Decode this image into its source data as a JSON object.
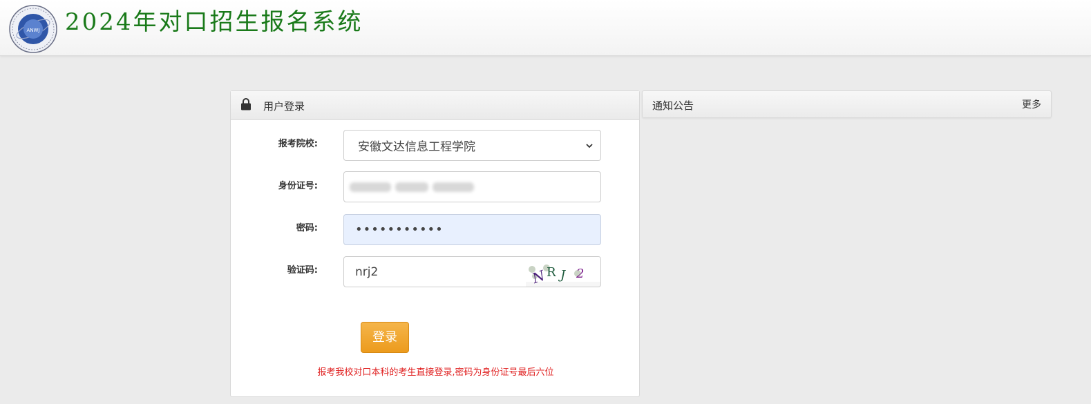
{
  "header": {
    "title": "2024年对口招生报名系统",
    "logo_text": "ANWJ"
  },
  "login": {
    "panel_title": "用户登录",
    "school_label": "报考院校:",
    "school_value": "安徽文达信息工程学院",
    "id_label": "身份证号:",
    "password_label": "密码:",
    "password_value": "•••••••••••",
    "captcha_label": "验证码:",
    "captcha_value": "nrj2",
    "captcha_image_text": [
      "N",
      "R",
      "J",
      "2"
    ],
    "login_button": "登录",
    "hint": "报考我校对口本科的考生直接登录,密码为身份证号最后六位"
  },
  "notice": {
    "title": "通知公告",
    "more": "更多"
  },
  "colors": {
    "title_green": "#1a7a1a",
    "button_orange": "#ec9b1d",
    "hint_red": "#e02020",
    "password_bg": "#e8f0fe"
  }
}
